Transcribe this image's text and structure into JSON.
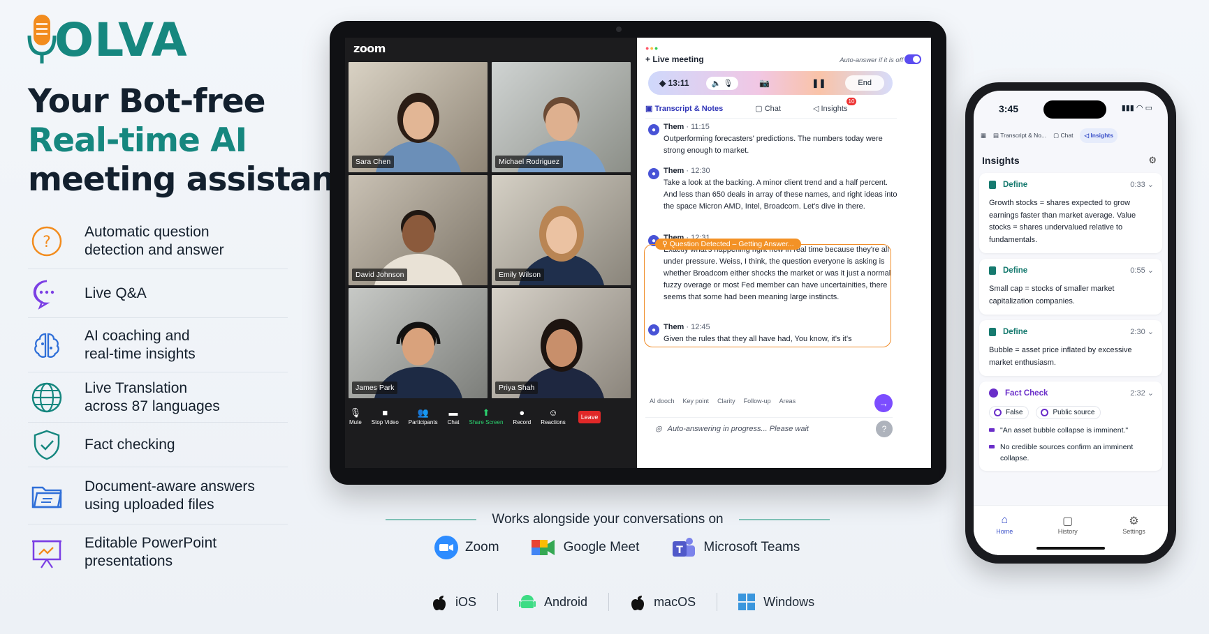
{
  "brand": {
    "name": "OLVA"
  },
  "headline": {
    "line1": "Your Bot-free",
    "line2": "Real-time AI",
    "line3": "meeting assistant"
  },
  "features": [
    {
      "label": "Automatic question\ndetection and answer",
      "icon": "question-icon"
    },
    {
      "label": "Live Q&A",
      "icon": "chat-bubble-icon"
    },
    {
      "label": "AI coaching and\nreal-time insights",
      "icon": "brain-icon"
    },
    {
      "label": "Live Translation\nacross 87 languages",
      "icon": "globe-icon"
    },
    {
      "label": "Fact checking",
      "icon": "shield-check-icon"
    },
    {
      "label": "Document-aware answers\nusing uploaded files",
      "icon": "folder-icon"
    },
    {
      "label": "Editable PowerPoint\npresentations",
      "icon": "presentation-icon"
    }
  ],
  "zoom": {
    "logo": "zoom",
    "participants": [
      "Sara Chen",
      "Michael Rodriguez",
      "David Johnson",
      "Emily Wilson",
      "James Park",
      "Priya Shah"
    ],
    "toolbar": [
      "Mute",
      "Stop Video",
      "Participants",
      "Chat",
      "Share Screen",
      "Record",
      "Reactions"
    ],
    "leave": "Leave"
  },
  "assistant": {
    "title": "Live meeting",
    "auto_answer": "Auto-answer if it is off",
    "timer": "13:11",
    "end": "End",
    "tabs": [
      "Transcript & Notes",
      "Chat",
      "Insights"
    ],
    "insights_badge": "10",
    "messages": [
      {
        "who": "Them",
        "time": "· 11:15",
        "text": "Outperforming forecasters' predictions. The numbers today were strong enough to market."
      },
      {
        "who": "Them",
        "time": "· 12:30",
        "text": "Take a look at the backing. A minor client trend and a half percent. And less than 650 deals in array of these names, and right ideas into the space Micron AMD, Intel, Broadcom. Let's dive in there."
      },
      {
        "who": "Them",
        "time": "· 12:31",
        "text": "Exactly what's happening right now in real time because they're all under pressure. Weiss, I think, the question everyone is asking is whether Broadcom either shocks the market or was it just a normal fuzzy overage or most Fed member can have uncertainities, there seems that some had been meaning large instincts."
      },
      {
        "who": "Them",
        "time": "· 12:45",
        "text": "Given the rules that they all have had, You know, it's it's"
      }
    ],
    "question_label": "Question Detected – Getting Answer...",
    "tools": [
      "AI dooch",
      "Key point",
      "Clarity",
      "Follow-up",
      "Areas"
    ],
    "input_text": "Auto-answering in progress... Please wait"
  },
  "works": {
    "title": "Works alongside your conversations on",
    "platforms": [
      "Zoom",
      "Google Meet",
      "Microsoft Teams"
    ],
    "os": [
      "iOS",
      "Android",
      "macOS",
      "Windows"
    ]
  },
  "phone": {
    "time": "3:45",
    "tabs": [
      "Transcript & No...",
      "Chat",
      "Insights"
    ],
    "title": "Insights",
    "cards": [
      {
        "type": "Define",
        "time": "0:33",
        "text": "Growth stocks = shares expected to grow earnings faster than market average. Value stocks = shares undervalued relative to fundamentals."
      },
      {
        "type": "Define",
        "time": "0:55",
        "text": "Small cap = stocks of smaller market capitalization companies."
      },
      {
        "type": "Define",
        "time": "2:30",
        "text": "Bubble = asset price inflated by excessive market enthusiasm."
      }
    ],
    "fact": {
      "type": "Fact Check",
      "time": "2:32",
      "chip1": "False",
      "chip2": "Public source",
      "claim": "\"An asset bubble collapse is imminent.\"",
      "verdict": "No credible sources confirm an imminent collapse."
    },
    "nav": [
      "Home",
      "History",
      "Settings"
    ]
  },
  "colors": {
    "teal": "#16877f",
    "orange": "#f39226",
    "purple": "#5b4cf0",
    "dark": "#13202e"
  }
}
